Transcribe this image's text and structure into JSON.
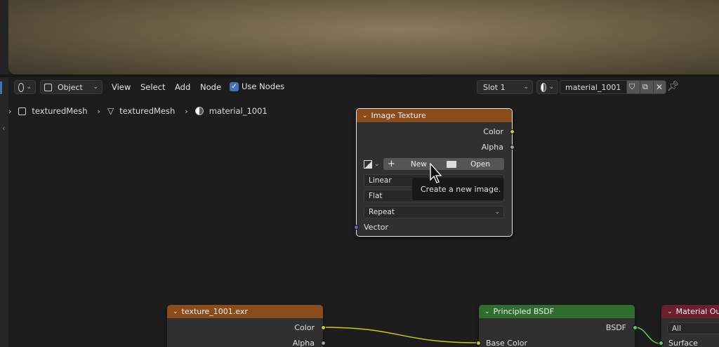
{
  "header": {
    "editor_type_icon": "node-editor-icon",
    "mode_label": "Object",
    "menus": [
      "View",
      "Select",
      "Add",
      "Node"
    ],
    "use_nodes_label": "Use Nodes",
    "use_nodes_checked": true,
    "slot_label": "Slot 1",
    "material_name": "material_1001"
  },
  "breadcrumb": {
    "object": "texturedMesh",
    "mesh": "texturedMesh",
    "material": "material_1001"
  },
  "image_texture_node": {
    "title": "Image Texture",
    "outputs": [
      "Color",
      "Alpha"
    ],
    "new_label": "New",
    "open_label": "Open",
    "interpolation": "Linear",
    "projection": "Flat",
    "extension": "Repeat",
    "input": "Vector",
    "header_color": "#8b4c1c"
  },
  "tooltip": {
    "text": "Create a new image."
  },
  "texture_node": {
    "title": "texture_1001.exr",
    "outputs": [
      "Color",
      "Alpha"
    ],
    "header_color": "#8b4c1c"
  },
  "bsdf_node": {
    "title": "Principled BSDF",
    "output": "BSDF",
    "input": "Base Color",
    "header_color": "#2f6d2f"
  },
  "output_node": {
    "title": "Material Outp",
    "target": "All",
    "input": "Surface",
    "header_color": "#6b1f2f"
  }
}
